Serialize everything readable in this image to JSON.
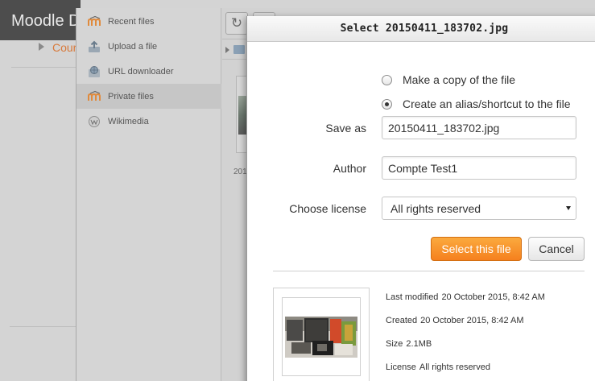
{
  "background": {
    "site_title": "Moodle D",
    "breadcrumb": "Cour"
  },
  "picker": {
    "repositories": [
      {
        "label": "Recent files",
        "icon": "moodle-m-icon"
      },
      {
        "label": "Upload a file",
        "icon": "upload-icon"
      },
      {
        "label": "URL downloader",
        "icon": "globe-link-icon"
      },
      {
        "label": "Private files",
        "icon": "moodle-m-icon"
      },
      {
        "label": "Wikimedia",
        "icon": "wikimedia-icon"
      }
    ],
    "active_repository": "Private files",
    "thumbnail_caption": "201"
  },
  "dialog": {
    "title": "Select 20150411_183702.jpg",
    "close_label": "x",
    "radio_copy": "Make a copy of the file",
    "radio_alias": "Create an alias/shortcut to the file",
    "save_as_label": "Save as",
    "save_as_value": "20150411_183702.jpg",
    "author_label": "Author",
    "author_value": "Compte Test1",
    "license_label": "Choose license",
    "license_value": "All rights reserved",
    "select_button": "Select this file",
    "cancel_button": "Cancel",
    "meta": {
      "last_modified_label": "Last modified",
      "last_modified_value": "20 October 2015, 8:42 AM",
      "created_label": "Created",
      "created_value": "20 October 2015, 8:42 AM",
      "size_label": "Size",
      "size_value": "2.1MB",
      "license_label": "License",
      "license_value": "All rights reserved"
    }
  },
  "colors": {
    "primary_button": "#f5801e",
    "moodle_orange": "#f98012",
    "breadcrumb_link": "#d8793a"
  }
}
